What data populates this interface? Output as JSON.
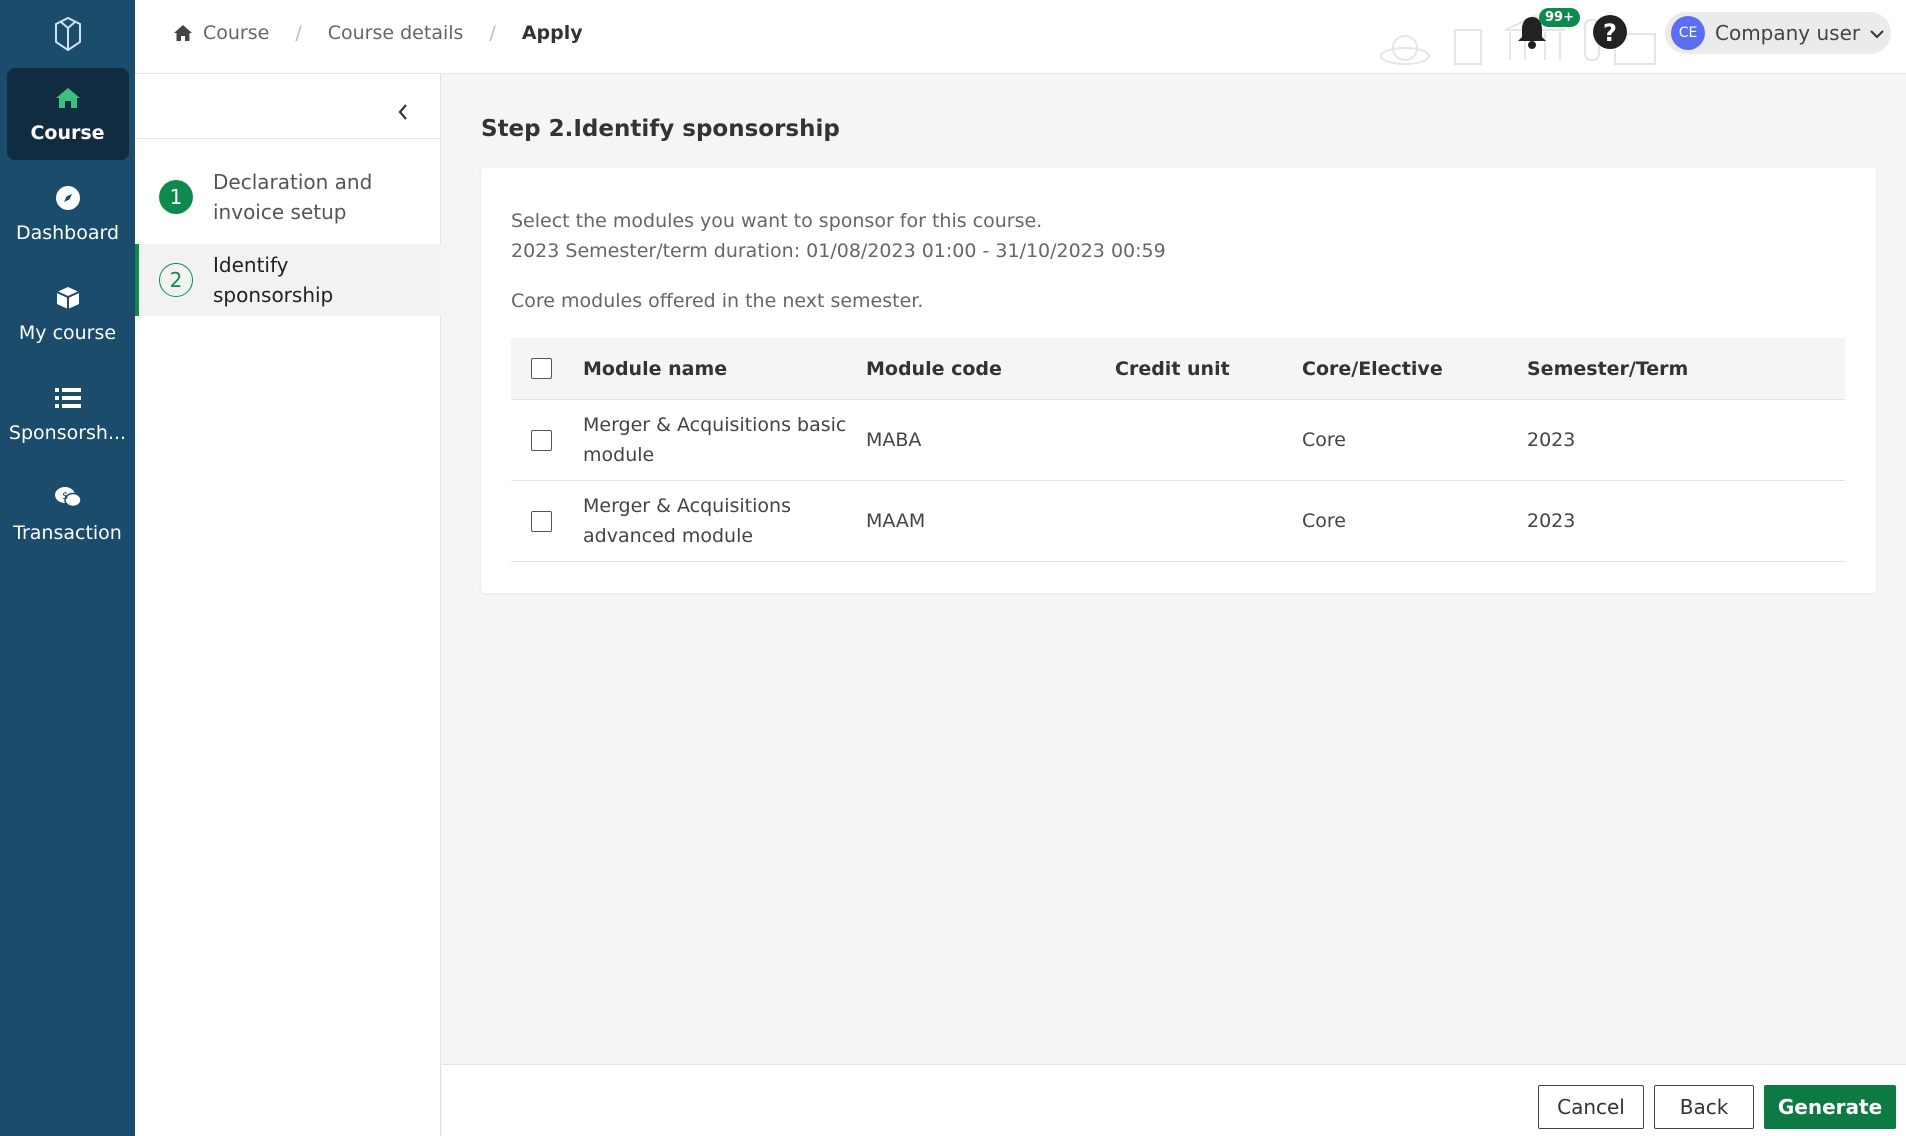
{
  "nav": {
    "items": [
      {
        "label": "Course",
        "icon": "home-icon"
      },
      {
        "label": "Dashboard",
        "icon": "compass-icon"
      },
      {
        "label": "My course",
        "icon": "box-icon"
      },
      {
        "label": "Sponsorsh...",
        "icon": "list-icon"
      },
      {
        "label": "Transaction",
        "icon": "chat-money-icon"
      }
    ]
  },
  "header": {
    "breadcrumb": [
      "Course",
      "Course details",
      "Apply"
    ],
    "notification_count": "99+",
    "user_initials": "CE",
    "user_name": "Company user"
  },
  "steps": [
    {
      "number": "1",
      "label": "Declaration and invoice setup"
    },
    {
      "number": "2",
      "label": "Identify sponsorship"
    }
  ],
  "main": {
    "title": "Step 2.Identify sponsorship",
    "desc1": "Select the modules you want to sponsor for this course.",
    "desc2": "2023 Semester/term duration: 01/08/2023 01:00 - 31/10/2023 00:59",
    "desc3": "Core modules offered in the next semester."
  },
  "table": {
    "headers": [
      "Module name",
      "Module code",
      "Credit unit",
      "Core/Elective",
      "Semester/Term"
    ],
    "rows": [
      {
        "name": "Merger & Acquisitions basic module",
        "code": "MABA",
        "credit": "",
        "type": "Core",
        "term": "2023"
      },
      {
        "name": "Merger & Acquisitions advanced module",
        "code": "MAAM",
        "credit": "",
        "type": "Core",
        "term": "2023"
      }
    ]
  },
  "footer": {
    "cancel": "Cancel",
    "back": "Back",
    "generate": "Generate"
  },
  "colors": {
    "nav_bg": "#1c4c6c",
    "nav_active": "#0f2c41",
    "accent_green": "#0e8a4f",
    "primary_button": "#0e7a43"
  }
}
